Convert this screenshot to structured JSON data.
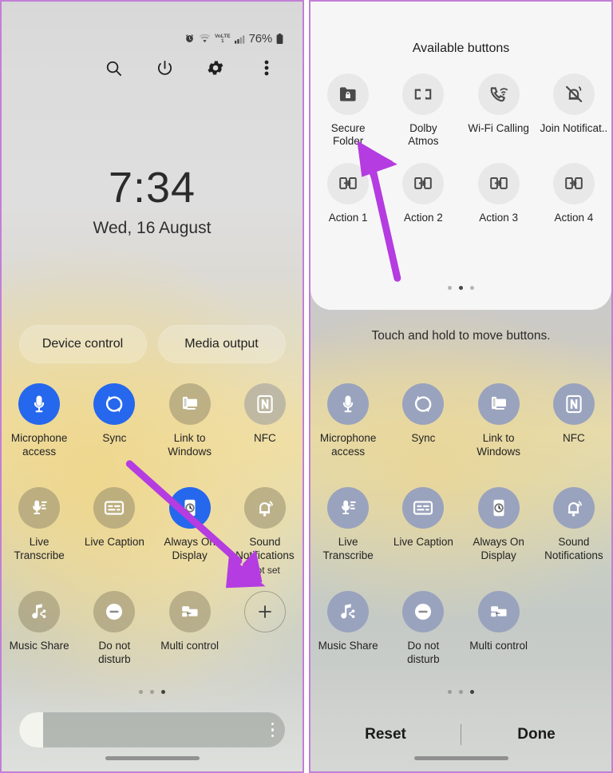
{
  "accent_purple": "#b43ce0",
  "accent_blue": "#2567ed",
  "panel_border": "#c27fd6",
  "left_phone": {
    "status_bar": {
      "alarm_icon": "alarm-icon",
      "wifi_icon": "wifi-icon",
      "volte_line1": "VoLTE",
      "volte_line2": "1",
      "signal_icon": "signal-bars-icon",
      "battery_text": "76%",
      "battery_icon": "battery-icon"
    },
    "header_buttons": [
      {
        "name": "search-icon",
        "label": "Search"
      },
      {
        "name": "power-icon",
        "label": "Power"
      },
      {
        "name": "gear-icon",
        "label": "Settings"
      },
      {
        "name": "more-options-icon",
        "label": "More options"
      }
    ],
    "clock": {
      "time": "7:34",
      "date": "Wed, 16 August"
    },
    "chips": [
      {
        "label": "Device control"
      },
      {
        "label": "Media output"
      }
    ],
    "tiles_row1": [
      {
        "label": "Microphone\naccess",
        "icon": "microphone-icon",
        "state": "on"
      },
      {
        "label": "Sync",
        "icon": "sync-icon",
        "state": "on"
      },
      {
        "label": "Link to\nWindows",
        "icon": "link-to-windows-icon",
        "state": "off"
      },
      {
        "label": "NFC",
        "icon": "nfc-icon",
        "state": "offg"
      }
    ],
    "tiles_row2": [
      {
        "label": "Live\nTranscribe",
        "icon": "live-transcribe-icon",
        "state": "off"
      },
      {
        "label": "Live Caption",
        "icon": "live-caption-icon",
        "state": "off"
      },
      {
        "label": "Always On\nDisplay",
        "icon": "always-on-display-icon",
        "state": "on"
      },
      {
        "label": "Sound\nNotifications",
        "sub": "Not set",
        "icon": "sound-notifications-icon",
        "state": "off"
      }
    ],
    "tiles_row3": [
      {
        "label": "Music Share",
        "icon": "music-share-icon",
        "state": "off"
      },
      {
        "label": "Do not\ndisturb",
        "icon": "do-not-disturb-icon",
        "state": "off"
      },
      {
        "label": "Multi control",
        "icon": "multi-control-icon",
        "state": "off"
      },
      {
        "label": "",
        "icon": "add-button-icon",
        "state": "plus"
      }
    ],
    "page_dots": {
      "count": 3,
      "active_index": 2
    },
    "brightness": {
      "value_pct": 9
    }
  },
  "right_phone": {
    "available_title": "Available buttons",
    "available_row1": [
      {
        "label": "Secure\nFolder",
        "icon": "secure-folder-icon"
      },
      {
        "label": "Dolby\nAtmos",
        "icon": "dolby-atmos-icon"
      },
      {
        "label": "Wi-Fi Calling",
        "icon": "wifi-calling-icon"
      },
      {
        "label": "Join Notificat..",
        "icon": "join-notifications-icon"
      }
    ],
    "available_row2": [
      {
        "label": "Action 1",
        "icon": "action-icon"
      },
      {
        "label": "Action 2",
        "icon": "action-icon"
      },
      {
        "label": "Action 3",
        "icon": "action-icon"
      },
      {
        "label": "Action 4",
        "icon": "action-icon"
      }
    ],
    "available_dots": {
      "count": 3,
      "active_index": 1
    },
    "hold_hint": "Touch and hold to move buttons.",
    "tiles_row1": [
      {
        "label": "Microphone\naccess",
        "icon": "microphone-icon"
      },
      {
        "label": "Sync",
        "icon": "sync-icon"
      },
      {
        "label": "Link to\nWindows",
        "icon": "link-to-windows-icon"
      },
      {
        "label": "NFC",
        "icon": "nfc-icon"
      }
    ],
    "tiles_row2": [
      {
        "label": "Live\nTranscribe",
        "icon": "live-transcribe-icon"
      },
      {
        "label": "Live Caption",
        "icon": "live-caption-icon"
      },
      {
        "label": "Always On\nDisplay",
        "icon": "always-on-display-icon"
      },
      {
        "label": "Sound\nNotifications",
        "icon": "sound-notifications-icon"
      }
    ],
    "tiles_row3": [
      {
        "label": "Music Share",
        "icon": "music-share-icon"
      },
      {
        "label": "Do not\ndisturb",
        "icon": "do-not-disturb-icon"
      },
      {
        "label": "Multi control",
        "icon": "multi-control-icon"
      }
    ],
    "page_dots": {
      "count": 3,
      "active_index": 2
    },
    "reset_label": "Reset",
    "done_label": "Done"
  },
  "annotations": [
    {
      "name": "arrow-to-add-button",
      "color": "#b43ce0",
      "panel": "left"
    },
    {
      "name": "arrow-to-secure-folder",
      "color": "#b43ce0",
      "panel": "right"
    }
  ]
}
